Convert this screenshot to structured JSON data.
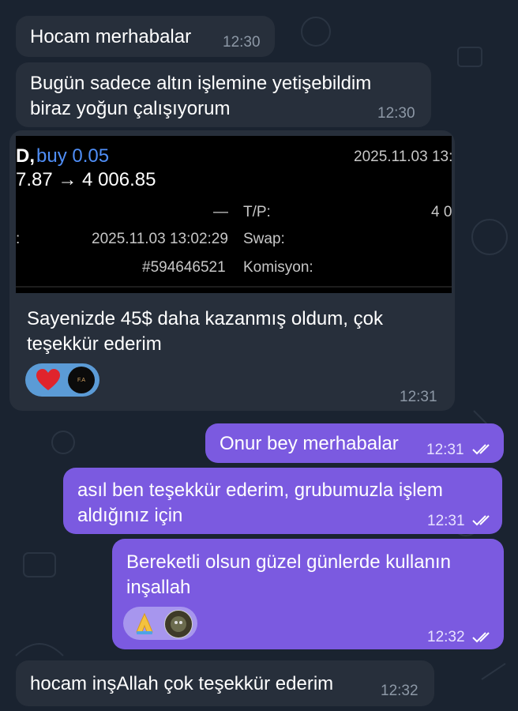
{
  "messages": [
    {
      "text": "Hocam merhabalar",
      "time": "12:30"
    },
    {
      "line1": "Bugün sadece altın işlemine yetişebildim",
      "line2": "biraz yoğun çalışıyorum",
      "time": "12:30"
    },
    {
      "line1": "Sayenizde 45$ daha kazanmış oldum, çok",
      "line2": "teşekkür ederim",
      "time": "12:31"
    },
    {
      "text": "Onur bey merhabalar",
      "time": "12:31"
    },
    {
      "line1": "asıl ben teşekkür ederim, grubumuzla işlem",
      "line2": "aldığınız için",
      "time": "12:31"
    },
    {
      "line1": "Bereketli olsun güzel günlerde kullanın",
      "line2": "inşallah",
      "time": "12:32"
    },
    {
      "text": "hocam inşAllah çok teşekkür ederim",
      "time": "12:32"
    }
  ],
  "trade": {
    "symbol_fragment": "D,",
    "side": "buy 0.05",
    "datetime_top": "2025.11.03 13:",
    "price_line": "7.87 → 4 006.85",
    "dash": "—",
    "tp_label": "T/P:",
    "tp_value": "4 0",
    "colon": ":",
    "open_time": "2025.11.03 13:02:29",
    "swap_label": "Swap:",
    "ticket": "#594646521",
    "commission_label": "Komisyon:"
  },
  "reactions": {
    "first": [
      "red-heart",
      "profile-avatar"
    ],
    "second": [
      "folded-hands",
      "sticker-avatar"
    ],
    "avatar_text": "F.A"
  },
  "colors": {
    "incoming_bubble": "#272f3b",
    "outgoing_bubble": "#7b5ae0",
    "background": "#1a2330",
    "trade_side_blue": "#4f8ef7"
  }
}
